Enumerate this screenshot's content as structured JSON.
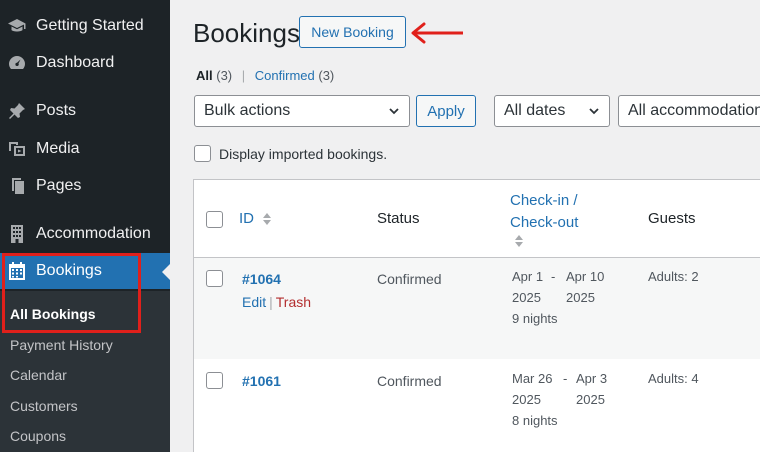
{
  "sidebar": {
    "items": [
      {
        "label": "Getting Started",
        "icon": "graduation-cap-icon"
      },
      {
        "label": "Dashboard",
        "icon": "dashboard-gauge-icon"
      },
      {
        "label": "Posts",
        "icon": "pin-icon"
      },
      {
        "label": "Media",
        "icon": "media-icon"
      },
      {
        "label": "Pages",
        "icon": "pages-icon"
      },
      {
        "label": "Accommodation",
        "icon": "building-icon"
      },
      {
        "label": "Bookings",
        "icon": "calendar-icon"
      }
    ],
    "submenu": [
      "All Bookings",
      "Payment History",
      "Calendar",
      "Customers",
      "Coupons"
    ]
  },
  "header": {
    "title": "Bookings",
    "new_button": "New Booking"
  },
  "filters": {
    "all_label": "All",
    "all_count": "(3)",
    "separator": "|",
    "confirmed_label": "Confirmed",
    "confirmed_count": "(3)"
  },
  "toolbar": {
    "bulk_actions": "Bulk actions",
    "apply": "Apply",
    "dates": "All dates",
    "accommodation": "All accommodation"
  },
  "imported_label": "Display imported bookings.",
  "table": {
    "columns": {
      "id": "ID",
      "status": "Status",
      "checkin_line1": "Check-in /",
      "checkin_line2": "Check-out",
      "guests": "Guests"
    },
    "rows": [
      {
        "id": "#1064",
        "status": "Confirmed",
        "checkin_day": "Apr 1",
        "checkin_year": "2025",
        "dash": "-",
        "checkout_day": "Apr 10",
        "checkout_year": "2025",
        "nights": "9 nights",
        "guests": "Adults: 2",
        "edit": "Edit",
        "trash": "Trash"
      },
      {
        "id": "#1061",
        "status": "Confirmed",
        "checkin_day": "Mar 26",
        "checkin_year": "2025",
        "dash": "-",
        "checkout_day": "Apr 3",
        "checkout_year": "2025",
        "nights": "8 nights",
        "guests": "Adults: 4"
      }
    ]
  },
  "colors": {
    "sidebar_bg": "#1d2327",
    "active_bg": "#2271b1",
    "highlight": "#e0201b",
    "link": "#2271b1"
  }
}
